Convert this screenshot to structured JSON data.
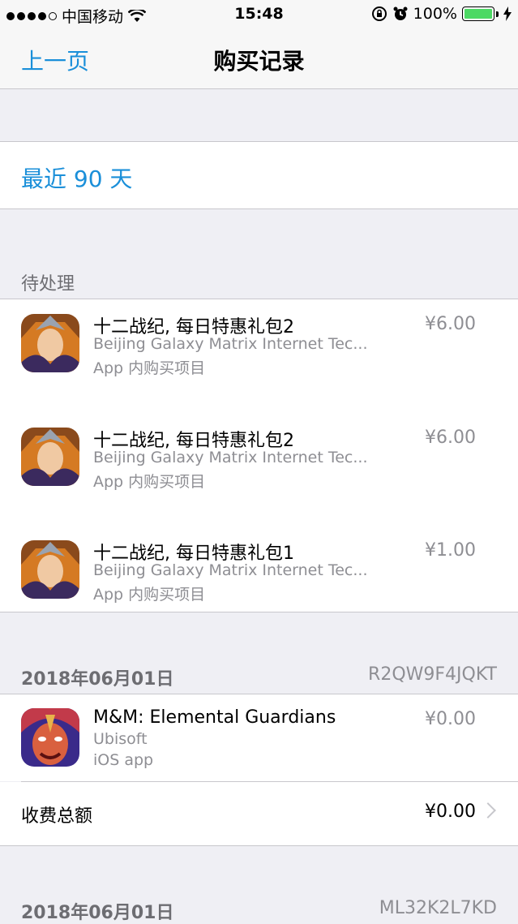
{
  "status_bar": {
    "carrier": "中国移动",
    "time": "15:48",
    "battery": "100%",
    "signal_bars_filled": 4,
    "signal_bars_total": 5,
    "wifi_icon": "wifi-icon",
    "lock_icon": "orientation-lock-icon",
    "alarm_icon": "alarm-icon",
    "charging_icon": "charging-bolt-icon"
  },
  "nav": {
    "back_label": "上一页",
    "title": "购买记录"
  },
  "filter": {
    "label": "最近 90 天"
  },
  "pending": {
    "header": "待处理",
    "items": [
      {
        "title": "十二战纪, 每日特惠礼包2",
        "developer": "Beijing Galaxy Matrix Internet Tec...",
        "type": "App 内购买项目",
        "price": "¥6.00"
      },
      {
        "title": "十二战纪, 每日特惠礼包2",
        "developer": "Beijing Galaxy Matrix Internet Tec...",
        "type": "App 内购买项目",
        "price": "¥6.00"
      },
      {
        "title": "十二战纪, 每日特惠礼包1",
        "developer": "Beijing Galaxy Matrix Internet Tec...",
        "type": "App 内购买项目",
        "price": "¥1.00"
      }
    ]
  },
  "orders": [
    {
      "date": "2018年06月01日",
      "order_id": "R2QW9F4JQKT",
      "items": [
        {
          "title": "M&M: Elemental Guardians",
          "developer": "Ubisoft",
          "type": "iOS app",
          "price": "¥0.00"
        }
      ],
      "total_label": "收费总额",
      "total_value": "¥0.00"
    },
    {
      "date": "2018年06月01日",
      "order_id": "ML32K2L7KD"
    }
  ],
  "colors": {
    "accent": "#1a8fd9",
    "background": "#efeff4",
    "battery": "#4cd964"
  }
}
